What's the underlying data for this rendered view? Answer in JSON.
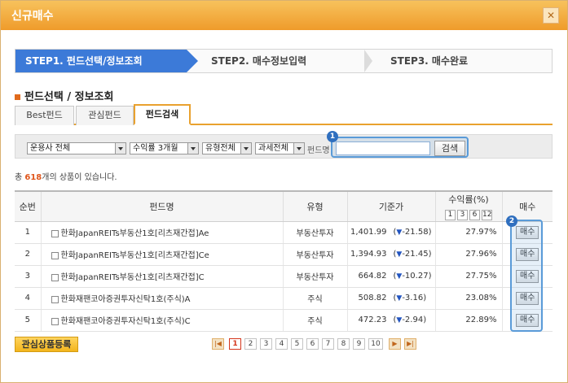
{
  "window": {
    "title": "신규매수",
    "close_glyph": "✕"
  },
  "steps": [
    {
      "label": "STEP1. 펀드선택/정보조회"
    },
    {
      "label": "STEP2. 매수정보입력"
    },
    {
      "label": "STEP3. 매수완료"
    }
  ],
  "section_title": "펀드선택 / 정보조회",
  "tabs": [
    {
      "label": "Best펀드"
    },
    {
      "label": "관심펀드"
    },
    {
      "label": "펀드검색"
    }
  ],
  "filters": {
    "company": "운용사 전체",
    "return_period": "수익률 3개월",
    "type": "유형전체",
    "tax": "과세전체",
    "fund_name_label": "펀드명",
    "fund_name_value": "",
    "search_label": "검색"
  },
  "badges": {
    "one": "1",
    "two": "2"
  },
  "summary": {
    "prefix": "총 ",
    "count": "618",
    "suffix": "개의 상품이 있습니다."
  },
  "table": {
    "headers": {
      "no": "순번",
      "fund": "펀드명",
      "type": "유형",
      "price": "기준가",
      "return": "수익률(%)",
      "buy": "매수"
    },
    "return_periods": [
      "1",
      "3",
      "6",
      "12"
    ],
    "rows": [
      {
        "no": "1",
        "fund": "한화JapanREITs부동산1호[리츠재간접]Ae",
        "type": "부동산투자",
        "price": "1,401.99",
        "change_arrow": "▼",
        "change": "-21.58",
        "return": "27.97%",
        "buy": "매수"
      },
      {
        "no": "2",
        "fund": "한화JapanREITs부동산1호[리츠재간접]Ce",
        "type": "부동산투자",
        "price": "1,394.93",
        "change_arrow": "▼",
        "change": "-21.45",
        "return": "27.96%",
        "buy": "매수"
      },
      {
        "no": "3",
        "fund": "한화JapanREITs부동산1호[리츠재간접]C",
        "type": "부동산투자",
        "price": "664.82",
        "change_arrow": "▼",
        "change": "-10.27",
        "return": "27.75%",
        "buy": "매수"
      },
      {
        "no": "4",
        "fund": "한화재팬코아증권투자신탁1호(주식)A",
        "type": "주식",
        "price": "508.82",
        "change_arrow": "▼",
        "change": "-3.16",
        "return": "23.08%",
        "buy": "매수"
      },
      {
        "no": "5",
        "fund": "한화재팬코아증권투자신탁1호(주식)C",
        "type": "주식",
        "price": "472.23",
        "change_arrow": "▼",
        "change": "-2.94",
        "return": "22.89%",
        "buy": "매수"
      }
    ]
  },
  "footer": {
    "favorite_button": "관심상품등록",
    "pager": {
      "first": "|◀",
      "prev": "◀",
      "pages": [
        "1",
        "2",
        "3",
        "4",
        "5",
        "6",
        "7",
        "8",
        "9",
        "10"
      ],
      "current": "1",
      "next": "▶",
      "last": "▶|"
    }
  }
}
